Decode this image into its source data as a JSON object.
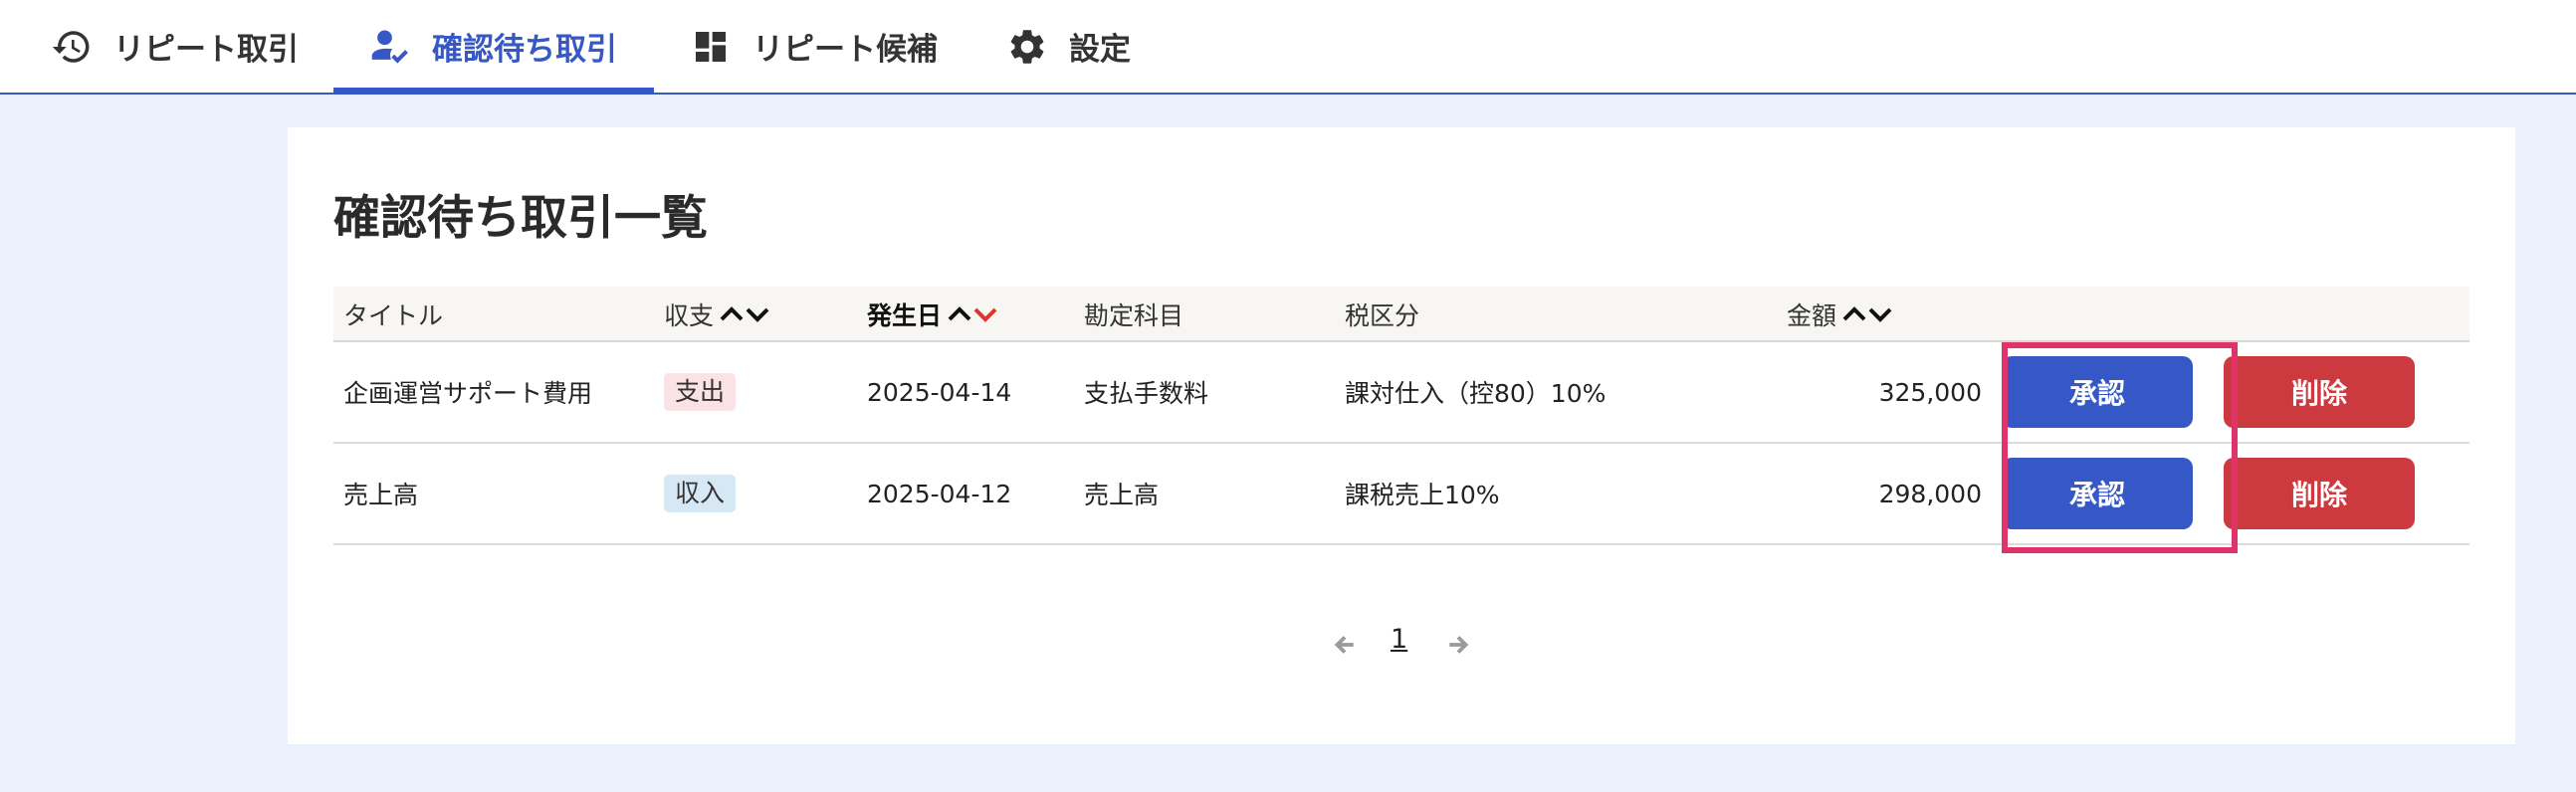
{
  "tabs": [
    {
      "label": "リピート取引",
      "icon": "history-icon",
      "active": false
    },
    {
      "label": "確認待ち取引",
      "icon": "user-check-icon",
      "active": true
    },
    {
      "label": "リピート候補",
      "icon": "dashboard-icon",
      "active": false
    },
    {
      "label": "設定",
      "icon": "gear-icon",
      "active": false
    }
  ],
  "page": {
    "title": "確認待ち取引一覧"
  },
  "table": {
    "columns": {
      "title": "タイトル",
      "type": "収支",
      "date": "発生日",
      "account": "勘定科目",
      "tax": "税区分",
      "amount": "金額"
    },
    "sorted_column": "発生日",
    "sorted_direction": "descending",
    "rows": [
      {
        "title": "企画運営サポート費用",
        "type": "支出",
        "date": "2025-04-14",
        "account": "支払手数料",
        "tax": "課対仕入（控80）10%",
        "amount": "325,000"
      },
      {
        "title": "売上高",
        "type": "収入",
        "date": "2025-04-12",
        "account": "売上高",
        "tax": "課税売上10%",
        "amount": "298,000"
      }
    ],
    "actions": {
      "approve": "承認",
      "delete": "削除"
    }
  },
  "pagination": {
    "current": "1"
  },
  "colors": {
    "accent": "#3658c6",
    "danger": "#cc3a40",
    "highlight": "#e0336a",
    "expense_badge": "#fbe3e5",
    "income_badge": "#d5e8f4",
    "sort_active": "#e0332b"
  }
}
